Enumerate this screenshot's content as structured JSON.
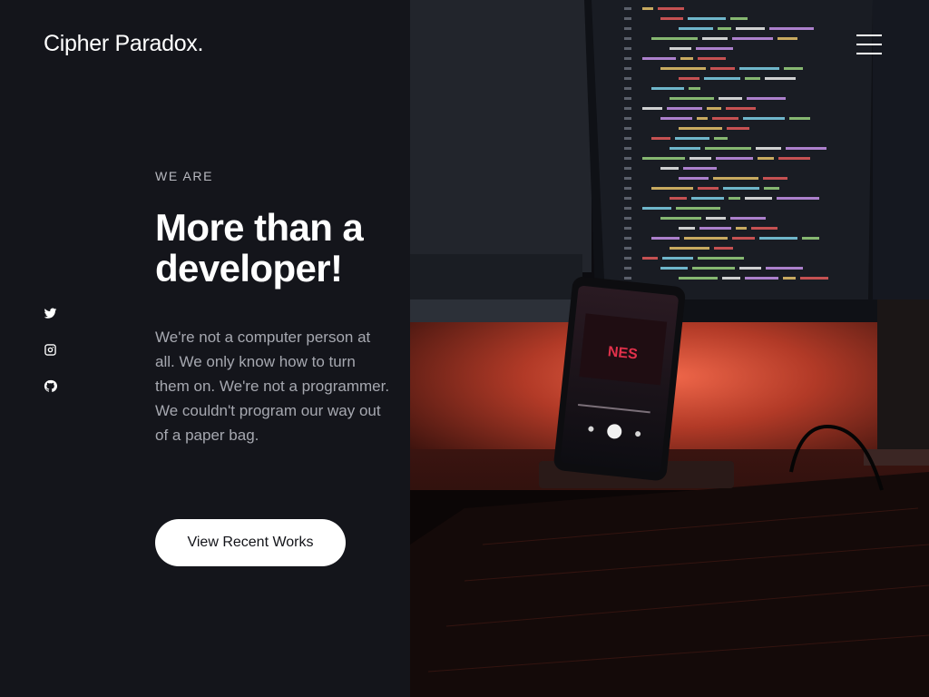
{
  "brand": {
    "logo_text": "Cipher Paradox."
  },
  "nav": {
    "menu_icon": "hamburger-menu-icon"
  },
  "social": [
    {
      "name": "twitter",
      "icon": "twitter-icon"
    },
    {
      "name": "instagram",
      "icon": "instagram-icon"
    },
    {
      "name": "github",
      "icon": "github-icon"
    }
  ],
  "hero": {
    "eyebrow": "WE ARE",
    "headline": "More than a developer!",
    "body": "We're not a computer person at all. We only know how to turn them on. We're not a programmer. We couldn't program our way out of a paper bag.",
    "cta_label": "View Recent Works"
  },
  "colors": {
    "panel_bg": "#14151b",
    "accent_glow": "#e2543c",
    "text_primary": "#ffffff",
    "text_muted": "#a6a8b0"
  }
}
